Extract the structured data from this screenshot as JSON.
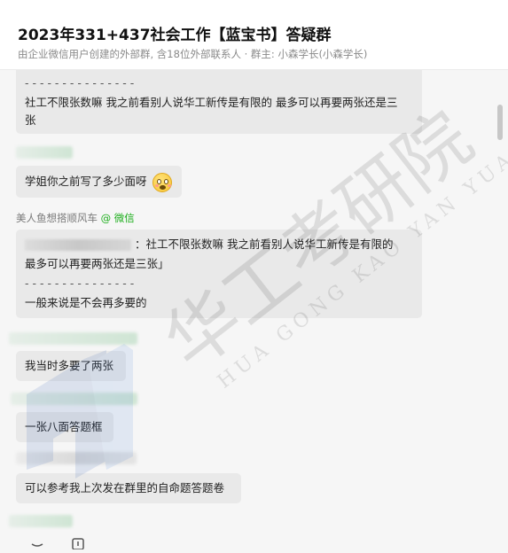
{
  "header": {
    "title": "2023年331+437社会工作【蓝宝书】答疑群",
    "subtitle": "由企业微信用户创建的外部群, 含18位外部联系人 · 群主: 小森学长(小森学长)"
  },
  "messages": {
    "m1_separator": "- - - - - - - - - - - - - - -",
    "m1_line1": "社工不限张数嘛 我之前看别人说华工新传是有限的 最多可以再要两张还是三",
    "m1_line2": "张",
    "m2_text": "学姐你之前写了多少面呀",
    "m3_sender": "美人鱼想搭顺风车",
    "m3_sender_tag": "@ 微信",
    "m3_quote_line1": "：社工不限张数嘛 我之前看别人说华工新传是有限的",
    "m3_quote_line2": "最多可以再要两张还是三张」",
    "m3_separator": "- - - - - - - - - - - - - - -",
    "m3_reply": "一般来说是不会再多要的",
    "m4_text": "我当时多要了两张",
    "m5_text": "一张八面答题框",
    "m6_text": "可以参考我上次发在群里的自命题答题卷"
  },
  "watermark": {
    "main": "华工考研院",
    "pinyin": "HUA GONG KAO YAN YUAN"
  },
  "colors": {
    "chat_bg": "#f6f6f6",
    "bubble_bg": "#e9e9e9",
    "wechat_tag": "#1aad19",
    "watermark_logo": "#2f5fb3"
  },
  "icons": {
    "emoji": "grimace-emoji",
    "toolbar": [
      "emoji-icon",
      "file-icon"
    ]
  }
}
